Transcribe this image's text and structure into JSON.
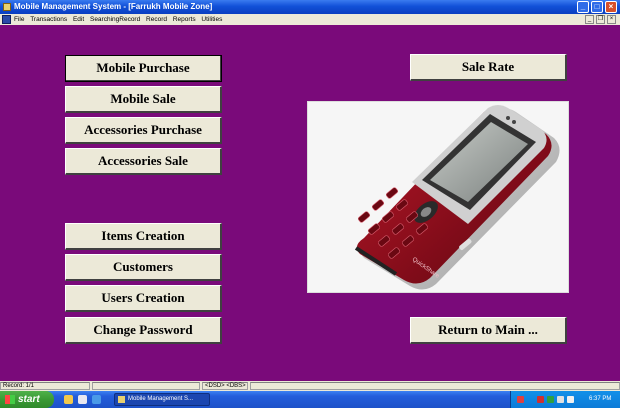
{
  "window": {
    "title": "Mobile Management System - [Farrukh Mobile Zone]",
    "controls": {
      "minimize": "_",
      "maximize": "□",
      "close": "×"
    }
  },
  "menu": {
    "items": [
      "File",
      "Transactions",
      "Edit",
      "SearchingRecord",
      "Record",
      "Reports",
      "Utilities"
    ],
    "mdi_controls": {
      "minimize": "_",
      "restore": "❐",
      "close": "×"
    }
  },
  "form": {
    "buttons": {
      "mobile_purchase": "Mobile Purchase",
      "mobile_sale": "Mobile Sale",
      "accessories_purchase": "Accessories Purchase",
      "accessories_sale": "Accessories Sale",
      "items_creation": "Items Creation",
      "customers": "Customers",
      "users_creation": "Users Creation",
      "change_password": "Change Password",
      "sale_rate": "Sale Rate",
      "return_to_main": "Return to Main ..."
    },
    "phone_screen_text": "QuickShare",
    "background_color": "#7a0a7a"
  },
  "statusbar": {
    "record": "Record: 1/1",
    "indicators": "<DSD> <DBS>"
  },
  "taskbar": {
    "start_label": "start",
    "task_item": "Mobile Management S...",
    "clock": "6:37 PM"
  }
}
